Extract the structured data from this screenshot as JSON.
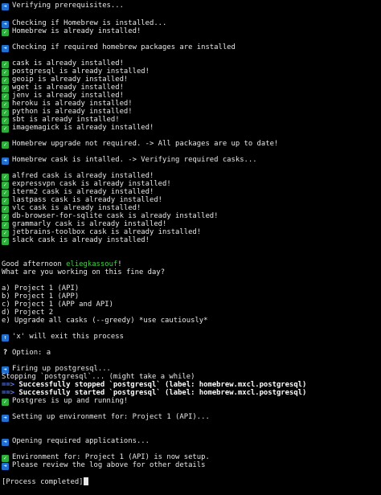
{
  "lines": {
    "l01": "Verifying prerequisites...",
    "l02": "Checking if Homebrew is installed...",
    "l03": "Homebrew is already installed!",
    "l04": "Checking if required homebrew packages are installed",
    "l05": "cask is already installed!",
    "l06": "postgresql is already installed!",
    "l07": "geoip is already installed!",
    "l08": "wget is already installed!",
    "l09": "jenv is already installed!",
    "l10": "heroku is already installed!",
    "l11": "python is already installed!",
    "l12": "sbt is already installed!",
    "l13": "imagemagick is already installed!",
    "l14": "Homebrew upgrade not required. -> All packages are up to date!",
    "l15": "Homebrew cask is intalled. -> Verifying required casks...",
    "l16": "alfred cask is already installed!",
    "l17": "expressvpn cask is already installed!",
    "l18": "iterm2 cask is already installed!",
    "l19": "lastpass cask is already installed!",
    "l20": "vlc cask is already installed!",
    "l21": "db-browser-for-sqlite cask is already installed!",
    "l22": "grammarly cask is already installed!",
    "l23": "jetbrains-toolbox cask is already installed!",
    "l24": "slack cask is already installed!",
    "l25a": "Good afternoon ",
    "l25b": "eliegkassouf",
    "l25c": "!",
    "l26": "What are you working on this fine day?",
    "l27": "a) Project 1 (API)",
    "l28": "b) Project 1 (APP)",
    "l29": "c) Project 1 (APP and API)",
    "l30": "d) Project 2",
    "l31": "e) Upgrade all casks (--greedy) *use cautiously*",
    "l32": "'x' will exit this process",
    "l33": "Option: a",
    "l34": "Firing up postgresql...",
    "l35": "Stopping `postgresql`... (might take a while)",
    "l36a": "==>",
    "l36b": " Successfully stopped `postgresql` (label: homebrew.mxcl.postgresql)",
    "l37a": "==>",
    "l37b": " Successfully started `postgresql` (label: homebrew.mxcl.postgresql)",
    "l38": "Postgres is up and running!",
    "l39": "Setting up environment for: Project 1 (API)...",
    "l40": "Opening required applications...",
    "l41": "Environment for: Project 1 (API) is now setup.",
    "l42": "Please review the log above for other details",
    "l43": "[Process completed]"
  },
  "icons": {
    "arrow": "right-arrow-emoji",
    "check": "check-mark-emoji",
    "up": "up-arrow-emoji",
    "question": "question-mark"
  },
  "colors": {
    "background": "#000000",
    "text": "#e8e8e8",
    "username": "#3ecf3e",
    "brew_arrow": "#5a7cff",
    "arrow_emoji": "#1f6fd1",
    "check_emoji": "#2cae3a"
  }
}
